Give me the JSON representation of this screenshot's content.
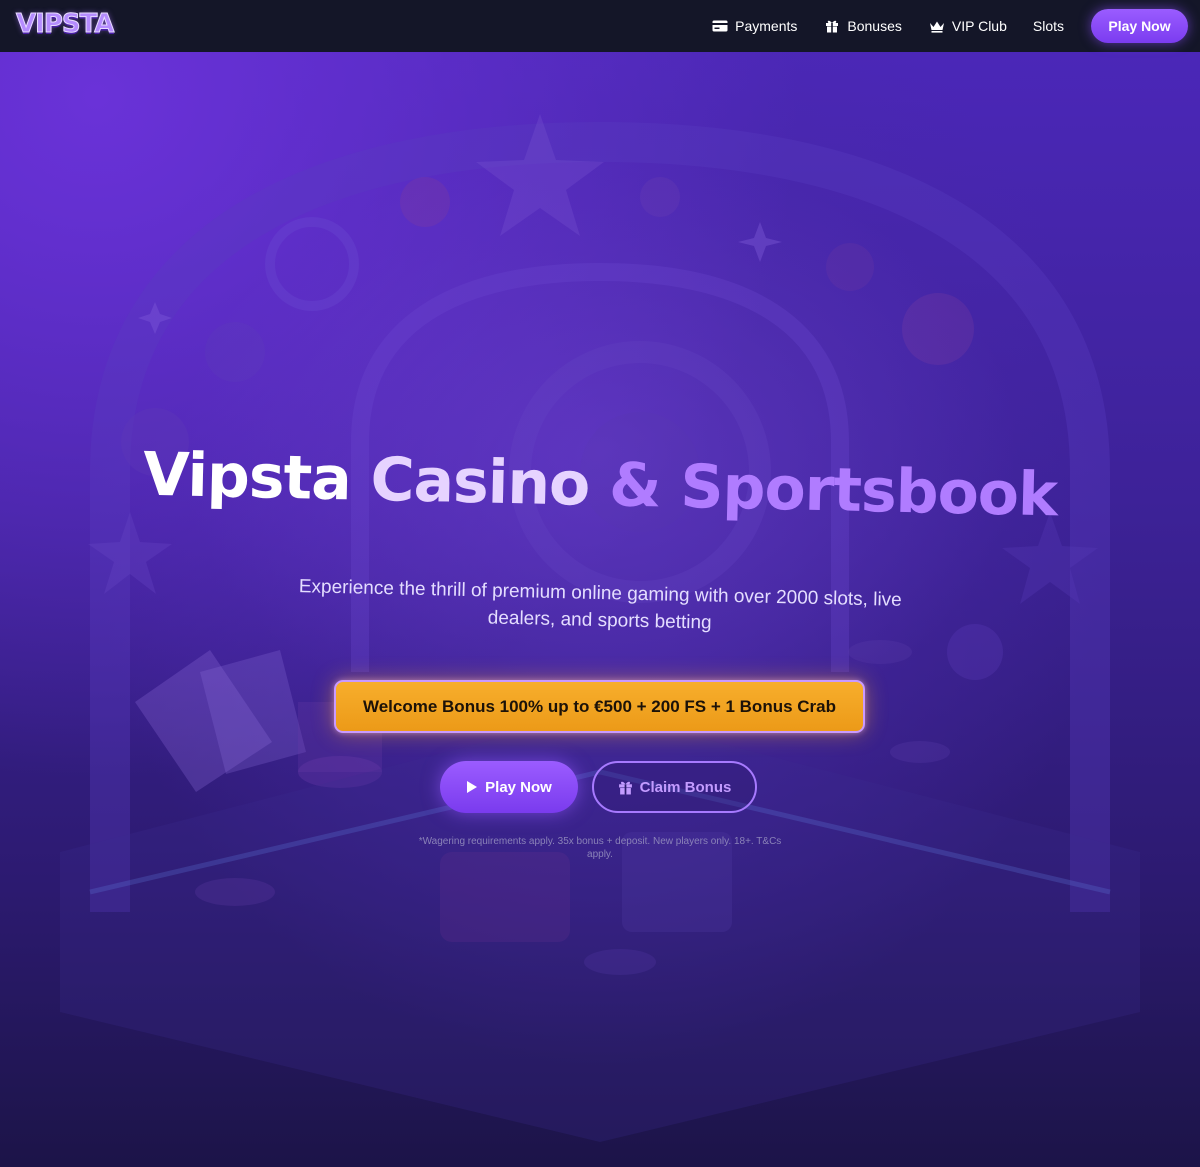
{
  "nav": {
    "logo": "VIPSTA",
    "links": [
      {
        "label": "Payments",
        "icon": "credit-card-icon"
      },
      {
        "label": "Bonuses",
        "icon": "gift-icon"
      },
      {
        "label": "VIP Club",
        "icon": "crown-icon"
      },
      {
        "label": "Slots",
        "icon": ""
      }
    ],
    "cta": "Play Now"
  },
  "hero": {
    "title_part1": "Vipsta",
    "title_part2": "Casino",
    "title_part3": "& Sportsbook",
    "subtitle": "Experience the thrill of premium online gaming with over 2000 slots, live dealers, and sports betting",
    "bonus_banner": "Welcome Bonus 100% up to €500 + 200 FS + 1 Bonus Crab",
    "play_button": "Play Now",
    "claim_button": "Claim Bonus",
    "disclaimer": "*Wagering requirements apply. 35x bonus + deposit. New players only. 18+. T&Cs apply."
  },
  "colors": {
    "nav_bg": "#141628",
    "accent_purple": "#8a4cff",
    "bonus_orange": "#f2a322",
    "hero_bg": "#3d2298"
  }
}
